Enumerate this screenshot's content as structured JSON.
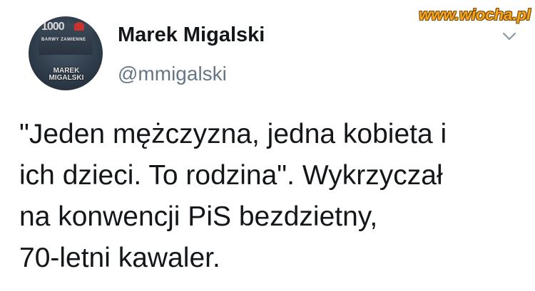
{
  "author": {
    "display_name": "Marek Migalski",
    "handle": "@mmigalski",
    "avatar": {
      "cover_number": "1000",
      "cover_series": "BARWY ZAMIENNE",
      "cover_author": "MAREK MIGALSKI"
    }
  },
  "watermark": "www.wiocha.pl",
  "menu_icon": "chevron-down-icon",
  "tweet": {
    "lines": [
      "\"Jeden mężczyzna, jedna kobieta i",
      "ich dzieci. To rodzina\". Wykrzyczał",
      "na konwencji PiS bezdzietny,",
      "70-letni kawaler."
    ]
  },
  "colors": {
    "text": "#14171a",
    "handle": "#657786",
    "watermark": "#f5a623"
  }
}
